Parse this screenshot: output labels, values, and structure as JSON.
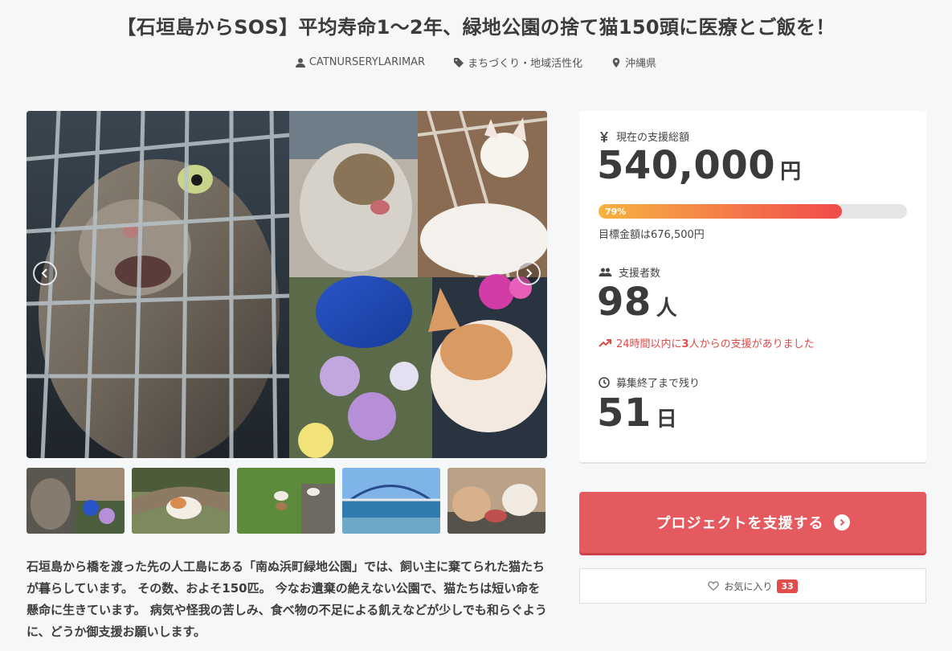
{
  "title": "【石垣島からSOS】平均寿命1〜2年、緑地公園の捨て猫150頭に医療とご飯を！",
  "meta": {
    "owner": "CATNURSERYLARIMAR",
    "category": "まちづくり・地域活性化",
    "location": "沖縄県"
  },
  "description": "石垣島から橋を渡った先の人工島にある「南ぬ浜町緑地公園」では、飼い主に棄てられた猫たちが暮らしています。 その数、およそ150匹。 今なお遺棄の絶えない公園で、猫たちは短い命を懸命に生きています。 病気や怪我の苦しみ、食べ物の不足による飢えなどが少しでも和らぐように、どうか御支援お願いします。",
  "stats": {
    "total_label": "現在の支援総額",
    "total_amount": "540,000",
    "total_unit": "円",
    "progress_text": "79%",
    "progress_percent": 79,
    "goal_text": "目標金額は676,500円",
    "supporters_label": "支援者数",
    "supporters_count": "98",
    "supporters_unit": "人",
    "trend_prefix": "24時間以内に",
    "trend_count": "3",
    "trend_suffix": "人からの支援がありました",
    "remaining_label": "募集終了まで残り",
    "remaining_days": "51",
    "remaining_unit": "日"
  },
  "actions": {
    "support_label": "プロジェクトを支援する",
    "favorite_label": "お気に入り",
    "favorite_count": "33"
  },
  "colors": {
    "accent": "#e55a5f",
    "trend": "#e04a47",
    "progress_start": "#f7b33f",
    "progress_end": "#ef4b4b"
  },
  "icons": {
    "owner": "user-icon",
    "category": "tag-icon",
    "location": "map-pin-icon",
    "total": "yen-icon",
    "supporters": "users-icon",
    "trend": "trending-up-icon",
    "remaining": "clock-icon",
    "support": "chevron-circle-right-icon",
    "favorite": "heart-icon"
  }
}
